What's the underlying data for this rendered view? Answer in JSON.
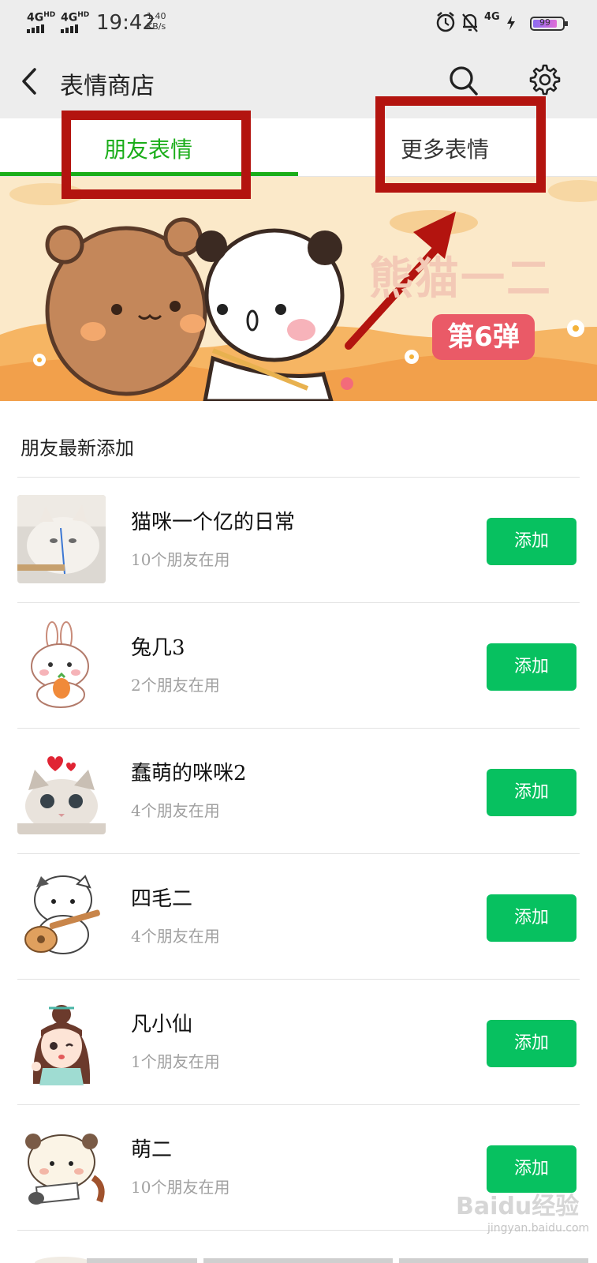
{
  "status_bar": {
    "signal1": "4G",
    "signal1_sup": "HD",
    "signal2": "4G",
    "signal2_sup": "HD",
    "time": "19:42",
    "net_speed": "1.40",
    "net_unit": "KB/s",
    "net_type": "4G",
    "battery": "99"
  },
  "header": {
    "title": "表情商店",
    "back_icon": "back-arrow-icon",
    "search_icon": "search-icon",
    "settings_icon": "gear-icon"
  },
  "tabs": {
    "friends": "朋友表情",
    "more": "更多表情",
    "active_color": "#1aad19"
  },
  "banner": {
    "title": "熊猫一二",
    "subtitle": "第6弹"
  },
  "section": {
    "title": "朋友最新添加"
  },
  "items": [
    {
      "name": "猫咪一个亿的日常",
      "users": "10个朋友在用",
      "button": "添加"
    },
    {
      "name": "兔几3",
      "users": "2个朋友在用",
      "button": "添加"
    },
    {
      "name": "蠢萌的咪咪2",
      "users": "4个朋友在用",
      "button": "添加"
    },
    {
      "name": "四毛二",
      "users": "4个朋友在用",
      "button": "添加"
    },
    {
      "name": "凡小仙",
      "users": "1个朋友在用",
      "button": "添加"
    },
    {
      "name": "萌二",
      "users": "10个朋友在用",
      "button": "添加"
    }
  ],
  "watermark": {
    "main": "Baidu经验",
    "sub": "jingyan.baidu.com"
  },
  "colors": {
    "accent": "#07c160",
    "annotation": "#b3140f"
  }
}
